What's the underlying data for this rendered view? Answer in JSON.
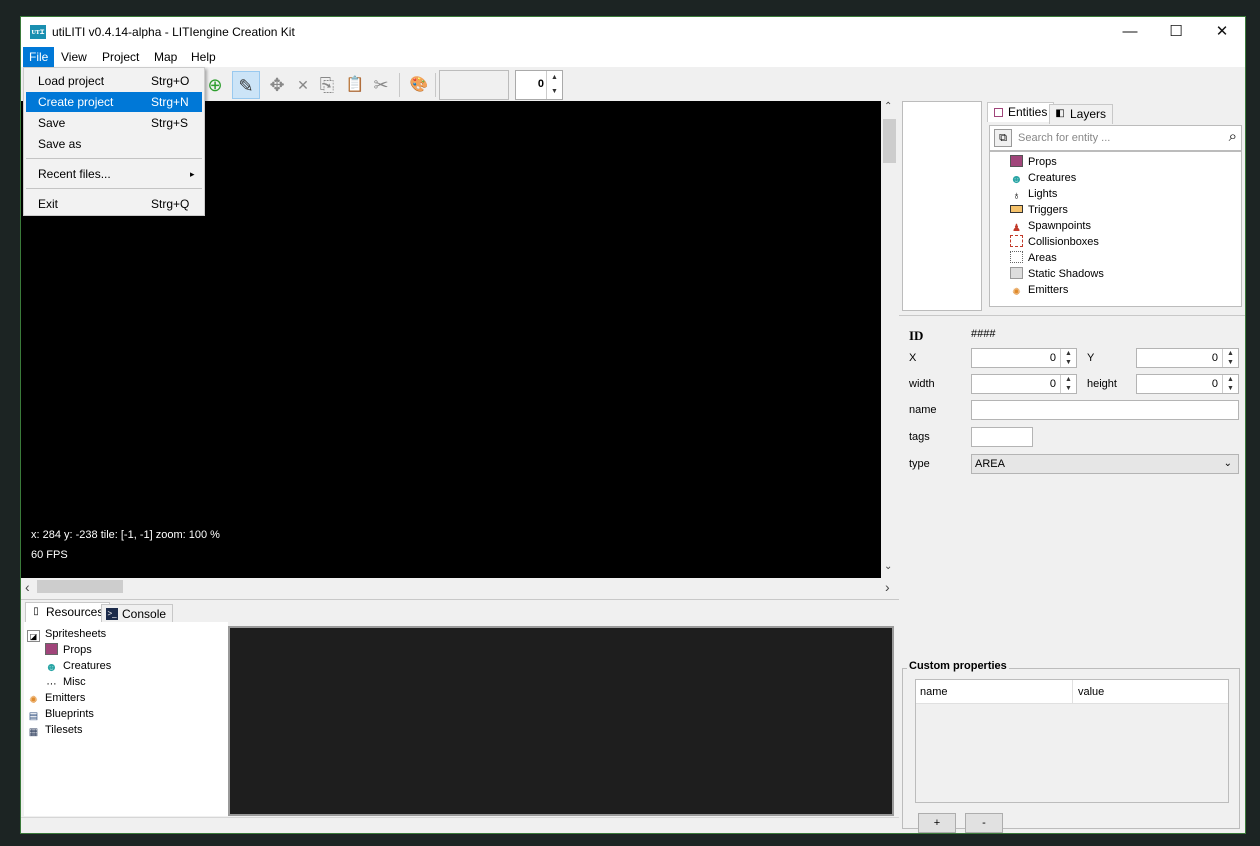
{
  "window": {
    "title": "utiLITI v0.4.14-alpha - LITIengine Creation Kit",
    "icon_text": "ᴜᴛɪ",
    "min": "—",
    "max": "☐",
    "close": "✕"
  },
  "menu": [
    "File",
    "View",
    "Project",
    "Map",
    "Help"
  ],
  "file_menu": {
    "load": {
      "label": "Load project",
      "shortcut": "Strg+O"
    },
    "create": {
      "label": "Create project",
      "shortcut": "Strg+N"
    },
    "save": {
      "label": "Save",
      "shortcut": "Strg+S"
    },
    "save_as": {
      "label": "Save as"
    },
    "recent": {
      "label": "Recent files...",
      "arrow": "▸"
    },
    "exit": {
      "label": "Exit",
      "shortcut": "Strg+Q"
    }
  },
  "toolbar": {
    "add": "⊕",
    "edit": "✎",
    "move": "✥",
    "delete": "✕",
    "copy": "⎘",
    "paste": "📋",
    "cut": "✂",
    "palette": "🎨",
    "spinner_value": "0",
    "up": "▲",
    "down": "▼"
  },
  "canvas": {
    "coords": "x: 284 y: -238 tile: [-1, -1] zoom: 100 %",
    "fps": "60 FPS"
  },
  "scroll": {
    "up": "⌃",
    "down": "⌄",
    "left": "‹",
    "right": "›"
  },
  "bottom": {
    "tabs": {
      "resources": "Resources",
      "console": "Console"
    },
    "tree": {
      "spritesheets": "Spritesheets",
      "props": "Props",
      "creatures": "Creatures",
      "misc": "Misc",
      "emitters": "Emitters",
      "blueprints": "Blueprints",
      "tilesets": "Tilesets"
    }
  },
  "entities": {
    "tabs": {
      "entities": "Entities",
      "layers": "Layers"
    },
    "search_placeholder": "Search for entity ...",
    "items": {
      "props": "Props",
      "creatures": "Creatures",
      "lights": "Lights",
      "triggers": "Triggers",
      "spawnpoints": "Spawnpoints",
      "collisionboxes": "Collisionboxes",
      "areas": "Areas",
      "static_shadows": "Static Shadows",
      "emitters": "Emitters"
    }
  },
  "properties": {
    "id_label": "ID",
    "id_value": "####",
    "x_label": "X",
    "x_value": "0",
    "y_label": "Y",
    "y_value": "0",
    "width_label": "width",
    "width_value": "0",
    "height_label": "height",
    "height_value": "0",
    "name_label": "name",
    "tags_label": "tags",
    "type_label": "type",
    "type_value": "AREA"
  },
  "custom_properties": {
    "title": "Custom properties",
    "col_name": "name",
    "col_value": "value",
    "add": "+",
    "remove": "-"
  },
  "colors": {
    "accent": "#0078d7",
    "canvas": "#000000",
    "frame": "#3a7a3a"
  }
}
